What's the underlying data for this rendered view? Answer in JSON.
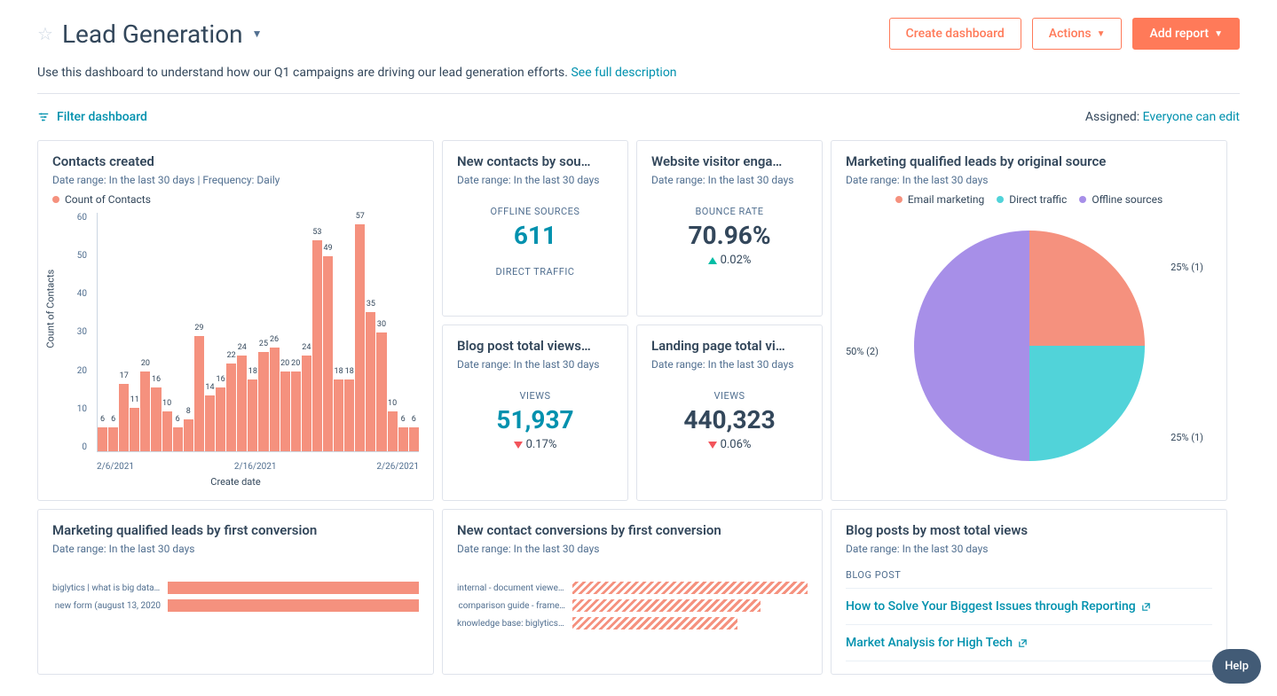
{
  "header": {
    "title": "Lead Generation",
    "create_btn": "Create dashboard",
    "actions_btn": "Actions",
    "add_report_btn": "Add report",
    "description": "Use this dashboard to understand how our Q1 campaigns are driving our lead generation efforts.",
    "see_full": "See full description"
  },
  "toolbar": {
    "filter_label": "Filter dashboard",
    "assigned_label": "Assigned:",
    "assigned_value": "Everyone can edit"
  },
  "cards": {
    "contacts_created": {
      "title": "Contacts created",
      "meta": "Date range: In the last 30 days  |  Frequency: Daily",
      "legend": "Count of Contacts"
    },
    "new_contacts_source": {
      "title": "New contacts by sou…",
      "meta": "Date range: In the last 30 days",
      "kpi1_label": "OFFLINE SOURCES",
      "kpi1_value": "611",
      "kpi2_label": "DIRECT TRAFFIC"
    },
    "website_engagement": {
      "title": "Website visitor enga…",
      "meta": "Date range: In the last 30 days",
      "kpi_label": "BOUNCE RATE",
      "kpi_value": "70.96%",
      "kpi_change": "0.02%"
    },
    "blog_views": {
      "title": "Blog post total views…",
      "meta": "Date range: In the last 30 days",
      "kpi_label": "VIEWS",
      "kpi_value": "51,937",
      "kpi_change": "0.17%"
    },
    "landing_views": {
      "title": "Landing page total vi…",
      "meta": "Date range: In the last 30 days",
      "kpi_label": "VIEWS",
      "kpi_value": "440,323",
      "kpi_change": "0.06%"
    },
    "mql_source": {
      "title": "Marketing qualified leads by original source",
      "meta": "Date range: In the last 30 days",
      "legend": {
        "email": "Email marketing",
        "direct": "Direct traffic",
        "offline": "Offline sources"
      }
    },
    "mql_conversion": {
      "title": "Marketing qualified leads by first conversion",
      "meta": "Date range: In the last 30 days"
    },
    "new_contact_conversions": {
      "title": "New contact conversions by first conversion",
      "meta": "Date range: In the last 30 days"
    },
    "blog_posts": {
      "title": "Blog posts by most total views",
      "meta": "Date range: In the last 30 days",
      "col_header": "BLOG POST",
      "rows": [
        "How to Solve Your Biggest Issues through Reporting",
        "Market Analysis for High Tech"
      ]
    }
  },
  "help": "Help",
  "chart_data": {
    "contacts_bar": {
      "type": "bar",
      "xlabel": "Create date",
      "ylabel": "Count of Contacts",
      "ylim": [
        0,
        60
      ],
      "yticks": [
        0,
        10,
        20,
        30,
        40,
        50,
        60
      ],
      "xticks": [
        "2/6/2021",
        "2/16/2021",
        "2/26/2021"
      ],
      "values": [
        6,
        6,
        17,
        11,
        20,
        16,
        10,
        6,
        8,
        29,
        14,
        16,
        22,
        24,
        18,
        25,
        26,
        20,
        20,
        24,
        53,
        49,
        18,
        18,
        57,
        35,
        30,
        10,
        6,
        6
      ],
      "color": "#f5917e"
    },
    "mql_pie": {
      "type": "pie",
      "series": [
        {
          "name": "Email marketing",
          "pct": 25,
          "count": 1,
          "color": "#f5917e"
        },
        {
          "name": "Direct traffic",
          "pct": 25,
          "count": 1,
          "color": "#51d3d9"
        },
        {
          "name": "Offline sources",
          "pct": 50,
          "count": 2,
          "color": "#a78fe8"
        }
      ],
      "labels": [
        "25% (1)",
        "25% (1)",
        "50% (2)"
      ]
    },
    "mql_first_conversion": {
      "type": "bar_h",
      "categories": [
        "biglytics | what is big data?: ebook form",
        "new form (august 13, 2020"
      ],
      "values": [
        100,
        100
      ]
    },
    "new_contact_first_conversion": {
      "type": "bar_h",
      "categories": [
        "internal - document viewer…",
        "comparison guide - frame…",
        "knowledge base: biglytics …"
      ],
      "values": [
        100,
        80,
        70
      ]
    }
  }
}
